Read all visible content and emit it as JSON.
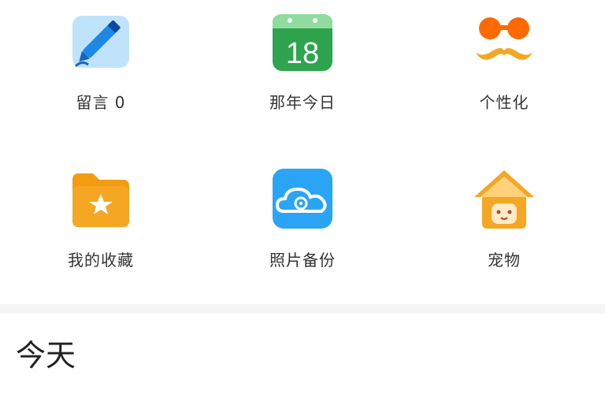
{
  "grid": {
    "items": [
      {
        "label": "留言 0",
        "icon": "pencil-icon"
      },
      {
        "label": "那年今日",
        "icon": "calendar-icon",
        "calendar_day": "18"
      },
      {
        "label": "个性化",
        "icon": "mustache-glasses-icon"
      },
      {
        "label": "我的收藏",
        "icon": "folder-star-icon"
      },
      {
        "label": "照片备份",
        "icon": "cloud-photo-icon"
      },
      {
        "label": "宠物",
        "icon": "pet-house-icon"
      }
    ]
  },
  "section": {
    "title": "今天"
  },
  "colors": {
    "pencil_bg": "#bfe3fb",
    "pencil": "#1e88e5",
    "calendar_green": "#2ea44f",
    "orange": "#f5a623",
    "orange_deep": "#ff8c1a",
    "cloud_blue": "#2aa4f4"
  }
}
